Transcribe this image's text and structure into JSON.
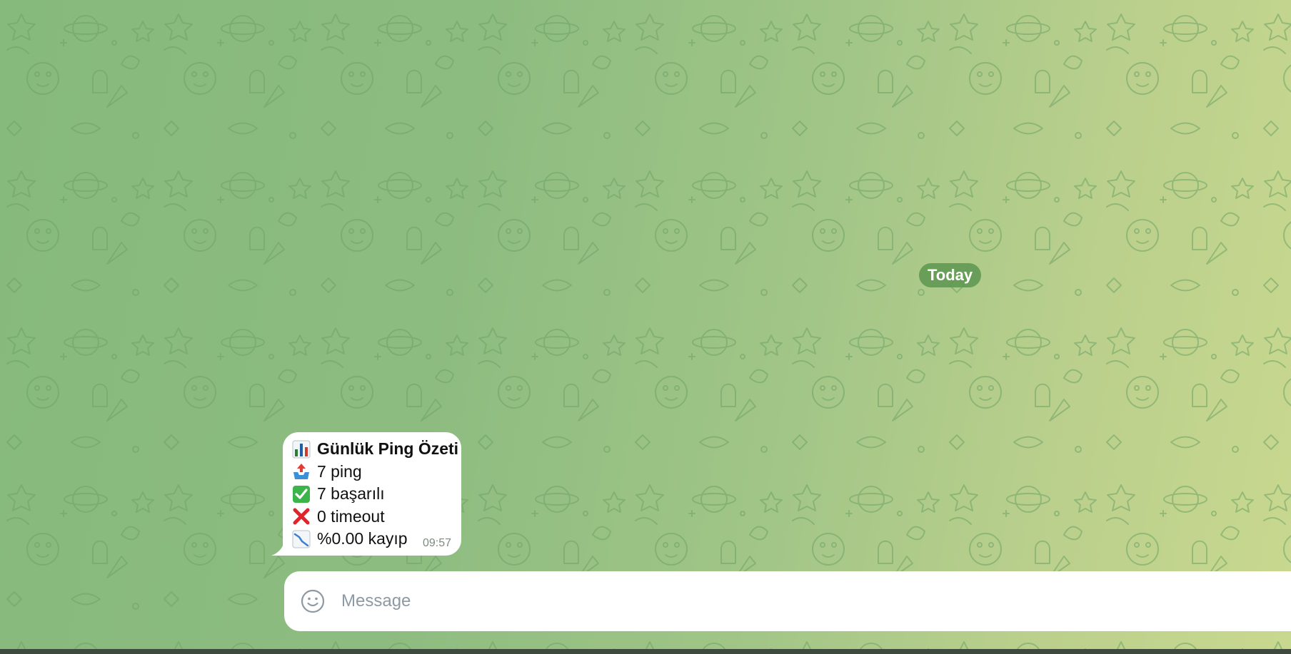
{
  "chat": {
    "date_separator": "Today"
  },
  "message": {
    "lines": [
      {
        "icon": "bar-chart-icon",
        "text": "Günlük Ping Özeti",
        "bold": true
      },
      {
        "icon": "outbox-tray-icon",
        "text": "7 ping"
      },
      {
        "icon": "check-mark-icon",
        "text": "7 başarılı"
      },
      {
        "icon": "cross-mark-icon",
        "text": "0 timeout"
      },
      {
        "icon": "chart-decreasing-icon",
        "text": "%0.00 kayıp"
      }
    ],
    "time": "09:57"
  },
  "composer": {
    "placeholder": "Message",
    "emoji_icon": "smiley-icon"
  },
  "colors": {
    "background_start": "#86b97c",
    "background_end": "#c9d88f",
    "bubble": "#ffffff",
    "date_pill": "#5c9650",
    "check_green": "#3bb54a",
    "cross_red": "#e0242b"
  }
}
